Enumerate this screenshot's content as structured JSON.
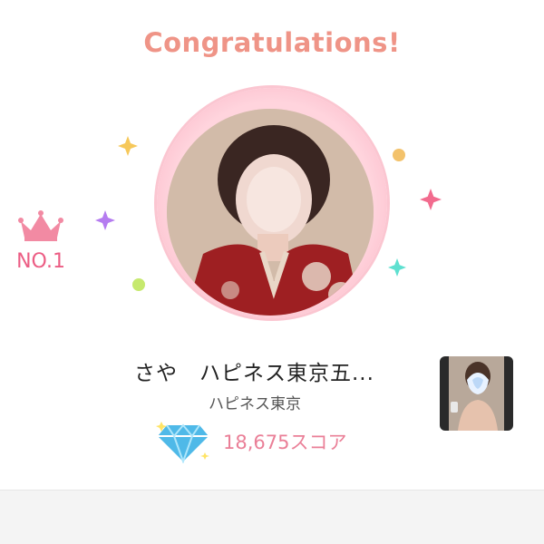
{
  "header": {
    "title": "Congratulations!"
  },
  "rank": {
    "label": "NO.1",
    "icon": "crown-icon"
  },
  "profile": {
    "name": "さや　ハピネス東京五...",
    "shop": "ハピネス東京",
    "score": "18,675スコア",
    "score_icon": "diamond-icon"
  },
  "colors": {
    "title": "#ef9487",
    "accent_pink": "#ec5d84",
    "ring": "#ffd4dd",
    "score_text": "#ea7f97"
  }
}
